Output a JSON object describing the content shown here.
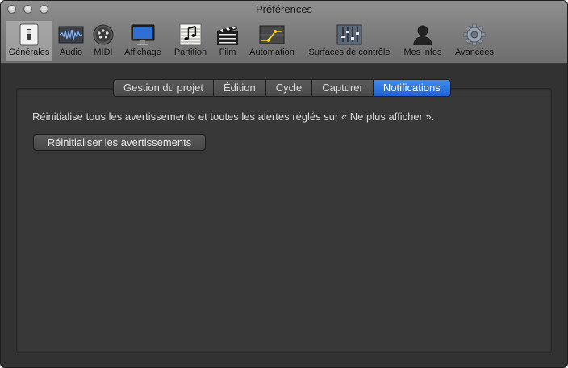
{
  "window": {
    "title": "Préférences"
  },
  "toolbar": {
    "items": [
      {
        "label": "Générales",
        "icon": "switch-icon",
        "selected": true
      },
      {
        "label": "Audio",
        "icon": "waveform-icon"
      },
      {
        "label": "MIDI",
        "icon": "midi-connector-icon"
      },
      {
        "label": "Affichage",
        "icon": "monitor-icon"
      },
      {
        "label": "Partition",
        "icon": "music-score-icon"
      },
      {
        "label": "Film",
        "icon": "clapperboard-icon"
      },
      {
        "label": "Automation",
        "icon": "automation-curve-icon"
      },
      {
        "label": "Surfaces de contrôle",
        "icon": "mixer-faders-icon"
      },
      {
        "label": "Mes infos",
        "icon": "person-silhouette-icon"
      },
      {
        "label": "Avancées",
        "icon": "gear-icon"
      }
    ]
  },
  "tabs": [
    {
      "label": "Gestion du projet"
    },
    {
      "label": "Édition"
    },
    {
      "label": "Cycle"
    },
    {
      "label": "Capturer"
    },
    {
      "label": "Notifications",
      "active": true
    }
  ],
  "notifications": {
    "description": "Réinitialise tous les avertissements et toutes les alertes réglés sur « Ne plus afficher ».",
    "reset_button": "Réinitialiser les avertissements"
  },
  "colors": {
    "accent": "#2a6fe0",
    "background": "#323232",
    "toolbar": "#7c7c7c"
  }
}
